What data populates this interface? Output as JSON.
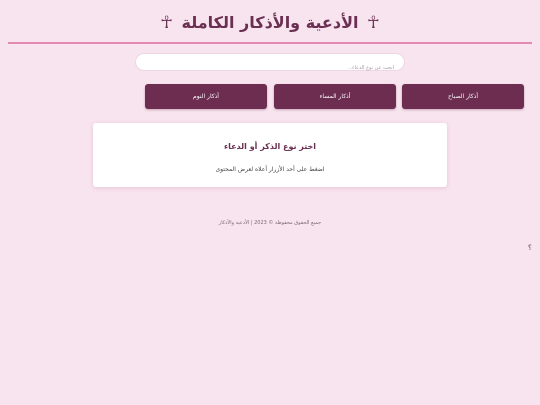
{
  "header": {
    "title": "الأدعية والأذكار الكاملة",
    "left_icon": "☥",
    "right_icon": "☥"
  },
  "search": {
    "placeholder": "ابحث عن نوع الدعاء..."
  },
  "buttons": {
    "morning": "أذكار الصباح",
    "evening": "أذكار المساء",
    "sleep": "أذكار النوم"
  },
  "card": {
    "title": "اختر نوع الذكر أو الدعاء",
    "text": "اضغط على أحد الأزرار أعلاه لعرض المحتوى"
  },
  "footer": {
    "text": "جميع الحقوق محفوظة © 2023 | الأدعية والأذكار"
  },
  "misc": {
    "corner_mark": "؟"
  },
  "colors": {
    "background": "#f8e4ee",
    "accent": "#6c2d50",
    "divider": "#e28ab2"
  }
}
